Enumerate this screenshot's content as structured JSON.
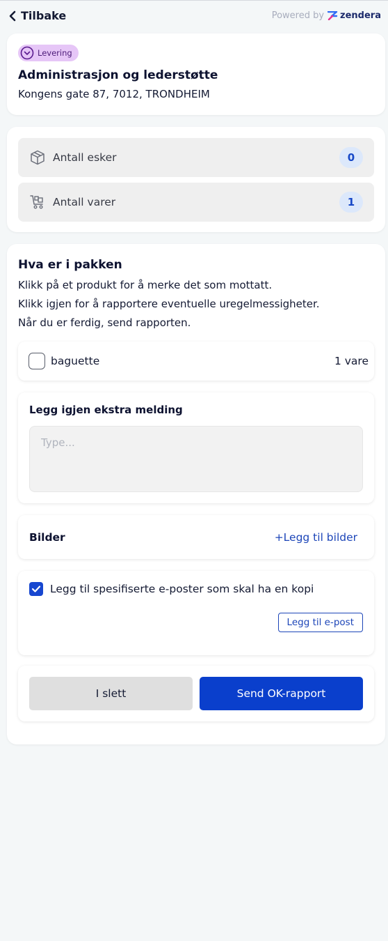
{
  "header": {
    "back_label": "Tilbake",
    "powered_by": "Powered by",
    "brand": "zendera"
  },
  "delivery": {
    "badge": "Levering",
    "title": "Administrasjon og lederstøtte",
    "address": "Kongens gate 87, 7012, TRONDHEIM"
  },
  "stats": [
    {
      "label": "Antall esker",
      "value": "0",
      "icon": "box-icon"
    },
    {
      "label": "Antall varer",
      "value": "1",
      "icon": "cart-icon"
    }
  ],
  "package": {
    "title": "Hva er i pakken",
    "instructions": [
      "Klikk på et produkt for å merke det som mottatt.",
      "Klikk igjen for å rapportere eventuelle uregelmessigheter.",
      "Når du er ferdig, send rapporten."
    ],
    "products": [
      {
        "name": "baguette",
        "qty": "1 vare",
        "checked": false
      }
    ]
  },
  "note": {
    "label": "Legg igjen ekstra melding",
    "placeholder": "Type..."
  },
  "photos": {
    "label": "Bilder",
    "add_label": "+Legg til bilder"
  },
  "cc": {
    "label": "Legg til spesifiserte e-poster som skal ha en kopi",
    "checked": true,
    "add_email_label": "Legg til e-post"
  },
  "actions": {
    "delete_label": "I slett",
    "send_label": "Send OK-rapport"
  },
  "colors": {
    "primary": "#0a3fcc",
    "badge_bg": "#e6c6f7",
    "count_bg": "#dce8fb"
  }
}
